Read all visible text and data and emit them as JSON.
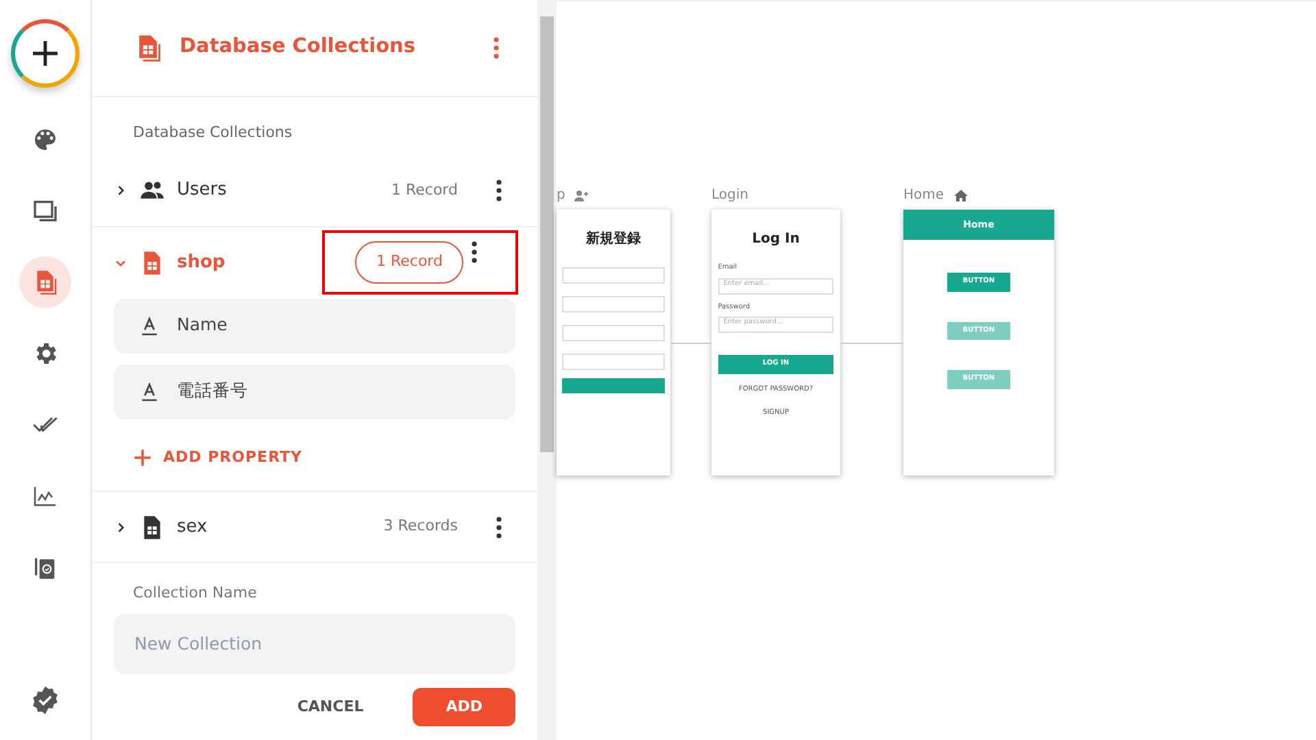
{
  "rail": {
    "items": [
      {
        "kind": "palette",
        "selected": false
      },
      {
        "kind": "screens",
        "selected": false
      },
      {
        "kind": "database",
        "selected": true
      },
      {
        "kind": "settings",
        "selected": false
      },
      {
        "kind": "checks",
        "selected": false
      },
      {
        "kind": "analytics",
        "selected": false
      },
      {
        "kind": "clipboard",
        "selected": false
      }
    ]
  },
  "panel": {
    "title": "Database Collections",
    "section_label": "Database Collections",
    "collections": [
      {
        "name": "Users",
        "kind": "users",
        "count": "1 Record",
        "expanded": false,
        "highlighted": false
      },
      {
        "name": "shop",
        "kind": "table",
        "count": "1 Record",
        "expanded": true,
        "highlighted": true,
        "properties": [
          "Name",
          "電話番号"
        ],
        "add_property": "ADD PROPERTY"
      },
      {
        "name": "sex",
        "kind": "table",
        "count": "3 Records",
        "expanded": false,
        "highlighted": false
      }
    ],
    "form": {
      "label": "Collection Name",
      "placeholder": "New Collection"
    },
    "buttons": [
      "CANCEL",
      "ADD"
    ]
  },
  "canvas": {
    "screens": [
      {
        "label": "p",
        "kind": "signup",
        "title": "新規登録"
      },
      {
        "label": "Login",
        "kind": "login",
        "title": "Log In",
        "texts": [
          "Email",
          "Enter email...",
          "Password",
          "Enter password...",
          "LOG IN",
          "FORGOT PASSWORD?",
          "SIGNUP"
        ]
      },
      {
        "label": "Home",
        "kind": "home",
        "title": "Home",
        "texts": [
          "BUTTON",
          "BUTTON",
          "BUTTON"
        ]
      }
    ]
  }
}
